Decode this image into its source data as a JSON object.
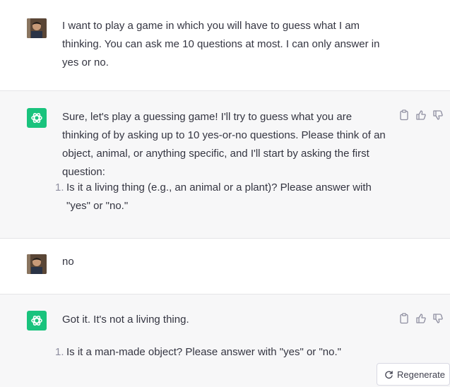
{
  "conversation": {
    "msg1": {
      "role": "user",
      "text": "I want to play a game in which you will have to guess what I am thinking. You can ask me 10 questions at most. I can only answer in yes or no."
    },
    "msg2": {
      "role": "assistant",
      "text": "Sure, let's play a guessing game! I'll try to guess what you are thinking of by asking up to 10 yes-or-no questions. Please think of an object, animal, or anything specific, and I'll start by asking the first question:",
      "list": [
        {
          "num": "1.",
          "text": "Is it a living thing (e.g., an animal or a plant)? Please answer with \"yes\" or \"no.\""
        }
      ]
    },
    "msg3": {
      "role": "user",
      "text": "no"
    },
    "msg4": {
      "role": "assistant",
      "text": "Got it. It's not a living thing.",
      "list": [
        {
          "num": "1.",
          "text": "Is it a man-made object? Please answer with \"yes\" or \"no.\""
        }
      ]
    }
  },
  "icons": {
    "user_avatar": "user-avatar-photo",
    "assistant_avatar": "openai-logo-icon",
    "copy": "clipboard-icon",
    "thumbs_up": "thumbs-up-icon",
    "thumbs_down": "thumbs-down-icon",
    "regenerate": "refresh-icon"
  },
  "regenerate_label": "Regenerate",
  "colors": {
    "assistant_bg": "#f7f7f8",
    "brand_green": "#19c37d",
    "text": "#343541",
    "muted": "#8e8ea0"
  }
}
